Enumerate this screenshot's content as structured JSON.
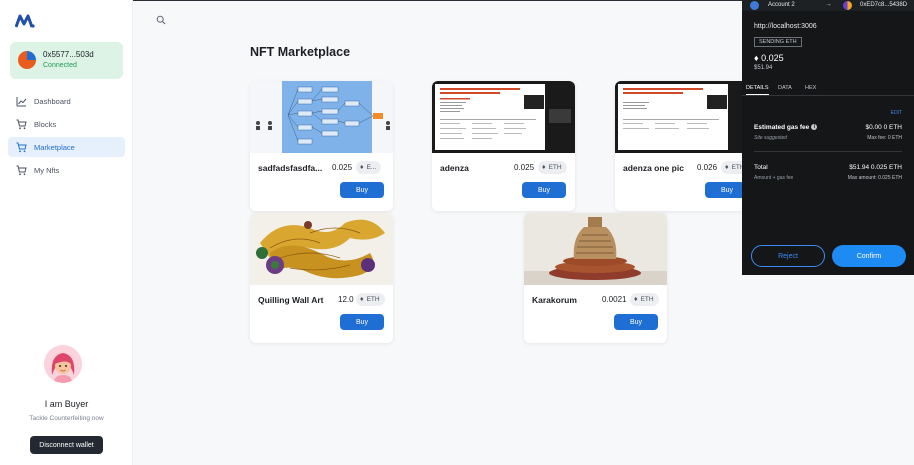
{
  "sidebar": {
    "wallet": {
      "address": "0x5577...503d",
      "status": "Connected"
    },
    "items": [
      {
        "label": "Dashboard",
        "icon": "chart-icon"
      },
      {
        "label": "Blocks",
        "icon": "cart-icon"
      },
      {
        "label": "Marketplace",
        "icon": "cart-icon",
        "active": true
      },
      {
        "label": "My Nfts",
        "icon": "cart-icon"
      }
    ],
    "profile": {
      "title": "I am Buyer",
      "subtitle": "Tackle Counterfeiting now"
    },
    "disconnect_label": "Disconnect wallet"
  },
  "main": {
    "title": "NFT Marketplace",
    "cards": [
      {
        "name": "sadfadsfasdfa...",
        "price": "0.025",
        "currency": "E...",
        "buy": "Buy",
        "image": "flowchart"
      },
      {
        "name": "adenza",
        "price": "0.025",
        "currency": "ETH",
        "buy": "Buy",
        "image": "slide"
      },
      {
        "name": "adenza one pic",
        "price": "0.026",
        "currency": "ETH",
        "buy": "Buy",
        "image": "slide"
      },
      {
        "name": "Quilling Wall Art",
        "price": "12.0",
        "currency": "ETH",
        "buy": "Buy",
        "image": "quilling"
      },
      {
        "name": "Karakorum",
        "price": "0.0021",
        "currency": "ETH",
        "buy": "Buy",
        "image": "basket"
      }
    ]
  },
  "metamask": {
    "account": "Account 2",
    "to_address": "0xED7c8...5438D",
    "origin": "http://localhost:3006",
    "badge": "SENDING ETH",
    "amount": "0.025",
    "fiat": "$51.94",
    "tabs": [
      "DETAILS",
      "DATA",
      "HEX"
    ],
    "edit": "EDIT",
    "gas_label": "Estimated gas fee",
    "gas_value": "$0.00 0 ETH",
    "site_suggested": "Site suggested",
    "max_fee": "Max fee: 0 ETH",
    "total_label": "Total",
    "total_value": "$51.94 0.025 ETH",
    "total_sub": "Amount + gas fee",
    "max_amount": "Max amount: 0.025 ETH",
    "reject": "Reject",
    "confirm": "Confirm"
  },
  "colors": {
    "accent": "#1f6ed4",
    "connected_bg": "#dcf3e6",
    "mm_bg": "#141618",
    "mm_confirm": "#1d8bf1"
  }
}
